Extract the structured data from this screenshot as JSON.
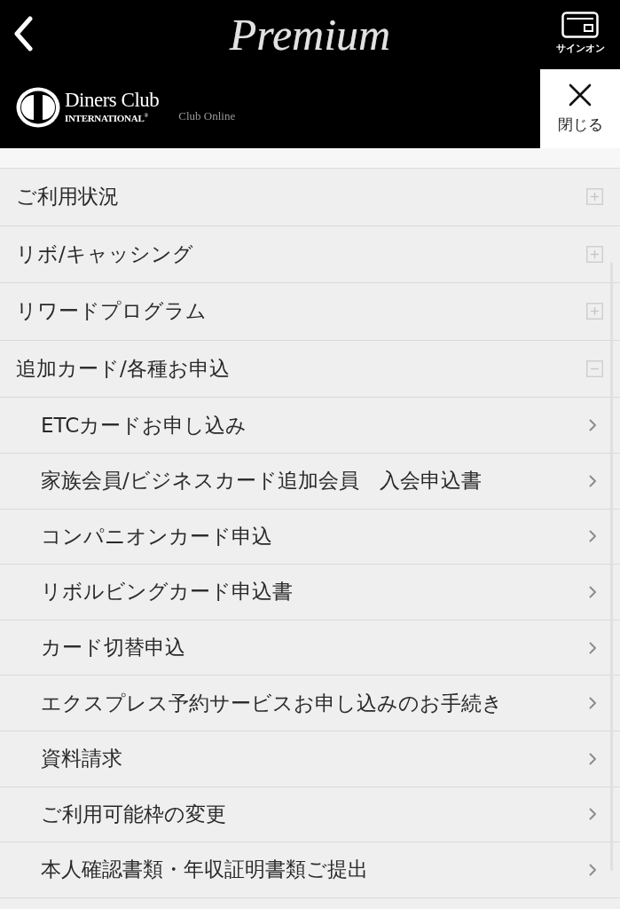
{
  "header": {
    "logo_text": "Premium",
    "sign_on": {
      "label": "サインオン"
    },
    "brand": {
      "name": "Diners Club",
      "subtitle": "INTERNATIONAL$^{®}$",
      "service": "Club Online"
    },
    "close": {
      "label": "閉じる"
    }
  },
  "menu": [
    {
      "label": "ご利用状況",
      "expanded": false
    },
    {
      "label": "リボ/キャッシング",
      "expanded": false
    },
    {
      "label": "リワードプログラム",
      "expanded": false
    },
    {
      "label": "追加カード/各種お申込",
      "expanded": true,
      "children": [
        {
          "label": "ETCカードお申し込み"
        },
        {
          "label": "家族会員/ビジネスカード追加会員　入会申込書"
        },
        {
          "label": "コンパニオンカード申込"
        },
        {
          "label": "リボルビングカード申込書"
        },
        {
          "label": "カード切替申込"
        },
        {
          "label": "エクスプレス予約サービスお申し込みのお手続き"
        },
        {
          "label": "資料請求"
        },
        {
          "label": "ご利用可能枠の変更"
        },
        {
          "label": "本人確認書類・年収証明書類ご提出"
        }
      ]
    }
  ]
}
